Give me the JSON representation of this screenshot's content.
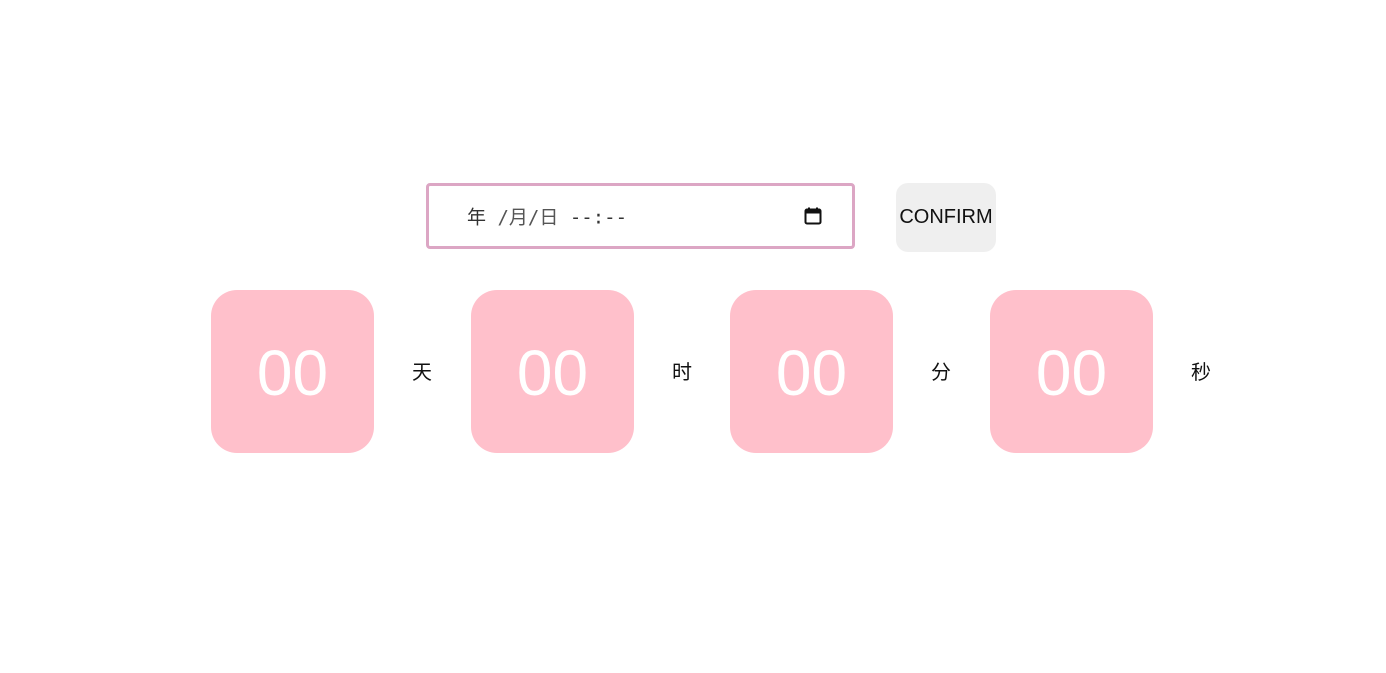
{
  "datetime_input": {
    "year_placeholder": "年",
    "month_placeholder": "/月",
    "day_placeholder": "/日",
    "time_placeholder": "--:--",
    "icon": "calendar-icon"
  },
  "confirm_button": {
    "label": "CONFIRM"
  },
  "countdown": {
    "days": {
      "value": "00",
      "unit": "天"
    },
    "hours": {
      "value": "00",
      "unit": "时"
    },
    "minutes": {
      "value": "00",
      "unit": "分"
    },
    "seconds": {
      "value": "00",
      "unit": "秒"
    }
  },
  "colors": {
    "tile_background": "#ffc0cb",
    "input_border": "#dca6c4",
    "button_background": "#efefef"
  }
}
